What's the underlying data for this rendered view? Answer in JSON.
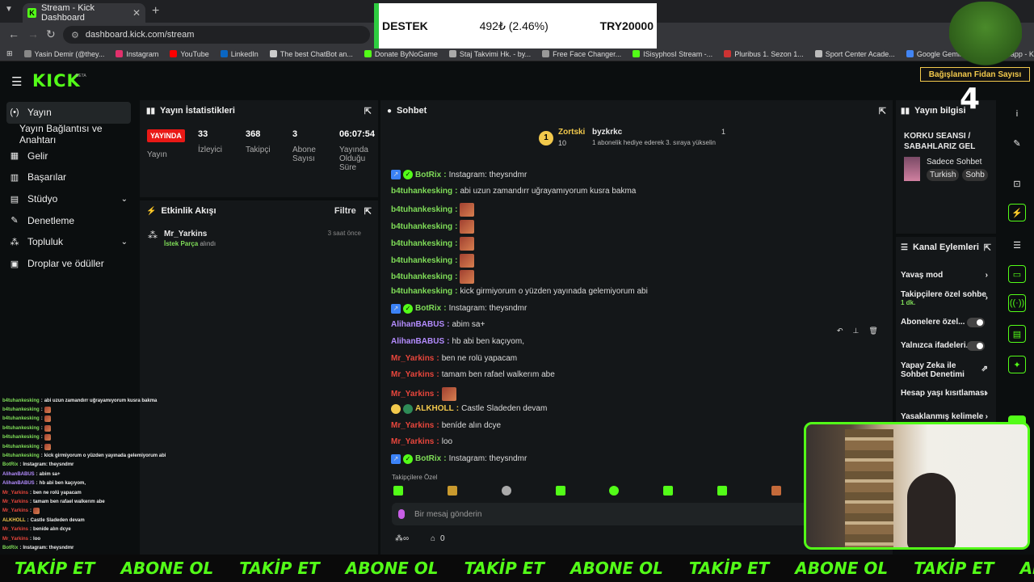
{
  "browser": {
    "tab_title": "Stream - Kick Dashboard",
    "url": "dashboard.kick.com/stream",
    "bookmarks": [
      "Yasin Demir (@they...",
      "Instagram",
      "YouTube",
      "LinkedIn",
      "The best ChatBot an...",
      "Donate ByNoGame",
      "Staj Takvimi Hk. - by...",
      "Free Face Changer...",
      "ISisyphosI Stream -...",
      "Pluribus 1. Sezon 1...",
      "Sport Center Acade...",
      "Google Gemini",
      "Kicklet.app - Kick C..."
    ]
  },
  "overlay_destek": {
    "label": "DESTEK",
    "change": "492₺ (2.46%)",
    "goal": "TRY20000"
  },
  "tree_overlay": {
    "label": "Bağışlanan Fidan Sayısı",
    "count": "4"
  },
  "kick": {
    "logo": "KICK",
    "beta": "BETA"
  },
  "nav": [
    {
      "label": "Yayın",
      "icon": "broadcast-icon"
    },
    {
      "label": "Yayın Bağlantısı ve Anahtarı",
      "icon": ""
    },
    {
      "label": "Gelir",
      "icon": "revenue-icon"
    },
    {
      "label": "Başarılar",
      "icon": "trophy-icon"
    },
    {
      "label": "Stüdyo",
      "icon": "studio-icon"
    },
    {
      "label": "Denetleme",
      "icon": "wrench-icon"
    },
    {
      "label": "Topluluk",
      "icon": "community-icon"
    },
    {
      "label": "Droplar ve ödüller",
      "icon": "gift-icon"
    }
  ],
  "stats": {
    "title": "Yayın İstatistikleri",
    "live_badge": "YAYINDA",
    "live_label": "Yayın",
    "viewers": {
      "value": "33",
      "label": "İzleyici"
    },
    "followers": {
      "value": "368",
      "label": "Takipçi"
    },
    "subs": {
      "value": "3",
      "label": "Abone Sayısı"
    },
    "duration": {
      "value": "06:07:54",
      "label": "Yayında Olduğu Süre"
    }
  },
  "feed": {
    "title": "Etkinlik Akışı",
    "filter": "Filtre",
    "items": [
      {
        "user": "Mr_Yarkins",
        "desc_highlight": "İstek Parça",
        "desc": "alındı",
        "time": "3 saat önce"
      }
    ]
  },
  "chat": {
    "title": "Sohbet",
    "pinned": {
      "user1": "Zortski",
      "count1": "10",
      "user2": "byzkrkc",
      "count2": "1",
      "msg": "1 abonelik hediye ederek 3. sıraya yükselin",
      "rank": "1"
    },
    "messages": [
      {
        "user": "BotRix",
        "color": "green",
        "text": "Instagram: theysndmr",
        "bot": true
      },
      {
        "user": "b4tuhankesking",
        "color": "green",
        "text": "abi uzun zamandırr uğrayamıyorum kusra bakma"
      },
      {
        "user": "b4tuhankesking",
        "color": "green",
        "text": "",
        "emote": true
      },
      {
        "user": "b4tuhankesking",
        "color": "green",
        "text": "",
        "emote": true
      },
      {
        "user": "b4tuhankesking",
        "color": "green",
        "text": "",
        "emote": true
      },
      {
        "user": "b4tuhankesking",
        "color": "green",
        "text": "",
        "emote": true
      },
      {
        "user": "b4tuhankesking",
        "color": "green",
        "text": "",
        "emote": true
      },
      {
        "user": "b4tuhankesking",
        "color": "green",
        "text": "kick girmiyorum o yüzden yayınada gelemiyorum abi"
      },
      {
        "user": "BotRix",
        "color": "green",
        "text": "Instagram: theysndmr",
        "bot": true
      },
      {
        "user": "AlihanBABUS",
        "color": "purple",
        "text": "abim sa+"
      },
      {
        "user": "AlihanBABUS",
        "color": "purple",
        "text": "hb abi ben kaçıyom,"
      },
      {
        "user": "Mr_Yarkins",
        "color": "red",
        "text": "ben ne rolü yapacam"
      },
      {
        "user": "Mr_Yarkins",
        "color": "red",
        "text": "tamam ben rafael walkerım abe"
      },
      {
        "user": "Mr_Yarkins",
        "color": "red",
        "text": "",
        "emote": true
      },
      {
        "user": "ALKHOLL",
        "color": "yellow",
        "text": "Castle Sladeden devam"
      },
      {
        "user": "Mr_Yarkins",
        "color": "red",
        "text": "beníde alın dcye"
      },
      {
        "user": "Mr_Yarkins",
        "color": "red",
        "text": "loo"
      },
      {
        "user": "BotRix",
        "color": "green",
        "text": "Instagram: theysndmr",
        "bot": true
      }
    ],
    "followers_only": "Takipçilere Özel",
    "input_placeholder": "Bir mesaj gönderin",
    "viewer_count": "0"
  },
  "stream_info": {
    "title": "Yayın bilgisi",
    "stream_title": "KORKU SEANSI / SABAHLARIZ GEL",
    "category": "Sadece Sohbet",
    "tags": [
      "Turkish",
      "Sohb"
    ]
  },
  "channel_actions": {
    "title": "Kanal Eylemleri",
    "items": [
      {
        "label": "Yavaş mod",
        "type": "arrow"
      },
      {
        "label": "Takipçilere özel sohbe",
        "sub": "1 dk.",
        "type": "arrow"
      },
      {
        "label": "Abonelere özel...",
        "type": "toggle"
      },
      {
        "label": "Yalnızca ifadeleri...",
        "type": "toggle"
      },
      {
        "label": "Yapay Zeka ile Sohbet Denetimi",
        "type": "external"
      },
      {
        "label": "Hesap yaşı kısıtlaması",
        "type": "arrow"
      },
      {
        "label": "Yasaklanmış kelimele",
        "type": "arrow"
      }
    ]
  },
  "overlay_chat": [
    {
      "user": "b4tuhankesking",
      "text": "abi uzun zamandırr uğrayamıyorum kusra bakma",
      "color": "#7fdd58"
    },
    {
      "user": "b4tuhankesking",
      "text": "",
      "color": "#7fdd58",
      "emote": true
    },
    {
      "user": "b4tuhankesking",
      "text": "",
      "color": "#7fdd58",
      "emote": true
    },
    {
      "user": "b4tuhankesking",
      "text": "",
      "color": "#7fdd58",
      "emote": true
    },
    {
      "user": "b4tuhankesking",
      "text": "",
      "color": "#7fdd58",
      "emote": true
    },
    {
      "user": "b4tuhankesking",
      "text": "",
      "color": "#7fdd58",
      "emote": true
    },
    {
      "user": "b4tuhankesking",
      "text": "kick girmiyorum o yüzden yayınada gelemiyorum abi",
      "color": "#7fdd58"
    },
    {
      "user": "BotRix",
      "text": "Instagram: theysndmr",
      "color": "#7fdd58"
    },
    {
      "user": "AlihanBABUS",
      "text": "abim sa+",
      "color": "#b48cff"
    },
    {
      "user": "AlihanBABUS",
      "text": "hb abi ben kaçıyom,",
      "color": "#b48cff"
    },
    {
      "user": "Mr_Yarkins",
      "text": "ben ne rolü yapacam",
      "color": "#e8463c"
    },
    {
      "user": "Mr_Yarkins",
      "text": "tamam ben rafael walkerım abe",
      "color": "#e8463c"
    },
    {
      "user": "Mr_Yarkins",
      "text": "",
      "color": "#e8463c",
      "emote": true
    },
    {
      "user": "ALKHOLL",
      "text": "Castle Sladeden devam",
      "color": "#f2c94c"
    },
    {
      "user": "Mr_Yarkins",
      "text": "beníde alın dcye",
      "color": "#e8463c"
    },
    {
      "user": "Mr_Yarkins",
      "text": "loo",
      "color": "#e8463c"
    },
    {
      "user": "BotRix",
      "text": "Instagram: theysndmr",
      "color": "#7fdd58"
    }
  ],
  "marquee": [
    "TAKİP ET",
    "ABONE OL",
    "TAKİP ET",
    "ABONE OL",
    "TAKİP ET",
    "ABONE OL",
    "TAKİP ET",
    "ABONE OL",
    "TAKİP ET",
    "ABONE OL"
  ],
  "colors": {
    "accent": "#53fc18",
    "live": "#e91916"
  }
}
